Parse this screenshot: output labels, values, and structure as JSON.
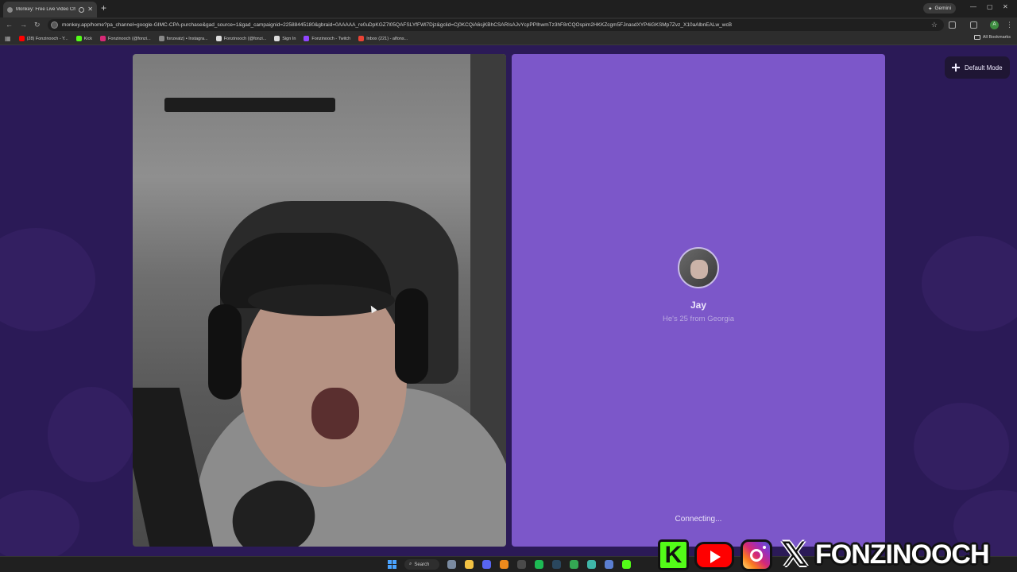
{
  "browser": {
    "tab": {
      "title": "Monkey: Free Live Video Ch"
    },
    "new_tab_symbol": "+",
    "gemini_label": "Gemini",
    "url": "monkey.app/home?pa_channel=google-GIMC-CPA-purchase&gad_source=1&gad_campaignid=22588445180&gbraid=0AAAAA_re0uDpKGZ7l05QAFSLYfFWl7Djz&gclid=Cj0KCQiA6sjKBhCSARIsAJvYcpPPIhwmTz3hF8rCQOspim2HKKZcgm5FJnasdXYP4iGKSMp7Zvz_X10aAlbnEALw_wcB",
    "bookmarks": [
      {
        "label": "(28) Fonzinooch - Y...",
        "color": "#ff0000"
      },
      {
        "label": "Kick",
        "color": "#53fc18"
      },
      {
        "label": "Fonzinooch (@fonzi...",
        "color": "#d62976"
      },
      {
        "label": "fonzeatz) • Instagra...",
        "color": "#888888"
      },
      {
        "label": "Fonzinooch (@fonzi...",
        "color": "#dddddd"
      },
      {
        "label": "Sign In",
        "color": "#dddddd"
      },
      {
        "label": "Fonzinooch - Twitch",
        "color": "#9146ff"
      },
      {
        "label": "Inbox (221) - alfons...",
        "color": "#ea4335"
      }
    ],
    "all_bookmarks_label": "All Bookmarks",
    "profile_initial": "A"
  },
  "app": {
    "mode_button": "Default Mode",
    "peer": {
      "name": "Jay",
      "info": "He's 25 from Georgia"
    },
    "status": "Connecting..."
  },
  "taskbar": {
    "search_label": "Search",
    "apps": [
      {
        "name": "settings-app",
        "color": "#7a8aa0"
      },
      {
        "name": "file-explorer-app",
        "color": "#f3c243"
      },
      {
        "name": "discord-app",
        "color": "#5865f2"
      },
      {
        "name": "vlc-app",
        "color": "#f08a1c"
      },
      {
        "name": "obs-app",
        "color": "#4a4a4a"
      },
      {
        "name": "spotify-app",
        "color": "#1db954"
      },
      {
        "name": "steam-app",
        "color": "#2a475e"
      },
      {
        "name": "chrome-app",
        "color": "#34a853"
      },
      {
        "name": "capture-app",
        "color": "#3fb6a8"
      },
      {
        "name": "browser-app",
        "color": "#5b7fd1"
      },
      {
        "name": "kick-app",
        "color": "#53fc18"
      }
    ]
  },
  "overlay": {
    "kick_letter": "K",
    "x_letter": "𝕏",
    "handle": "FONZINOOCH"
  }
}
